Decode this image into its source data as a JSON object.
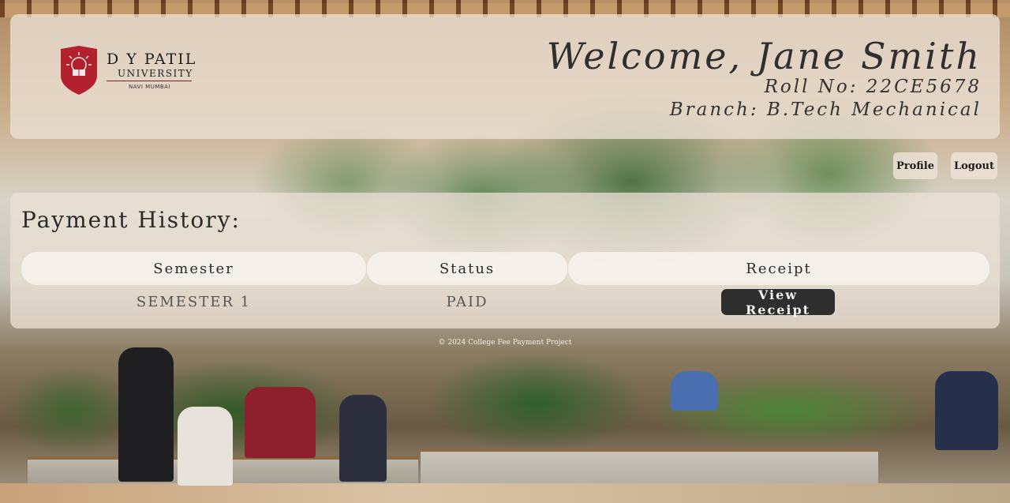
{
  "header": {
    "logo": {
      "name": "D Y PATIL",
      "subtitle": "UNIVERSITY",
      "location": "NAVI MUMBAI"
    },
    "welcome": "Welcome, Jane Smith",
    "roll": "Roll No: 22CE5678",
    "branch": "Branch: B.Tech Mechanical"
  },
  "nav": {
    "profile_label": "Profile",
    "logout_label": "Logout"
  },
  "payment": {
    "title": "Payment History:",
    "columns": [
      "Semester",
      "Status",
      "Receipt"
    ],
    "rows": [
      {
        "semester": "SEMESTER 1",
        "status": "PAID",
        "receipt_label": "View Receipt"
      }
    ]
  },
  "footer": {
    "text": "© 2024 College Fee Payment Project"
  },
  "colors": {
    "brand_red": "#b3202e",
    "button_dark": "#2e2e2e",
    "panel": "#ece2d6"
  }
}
